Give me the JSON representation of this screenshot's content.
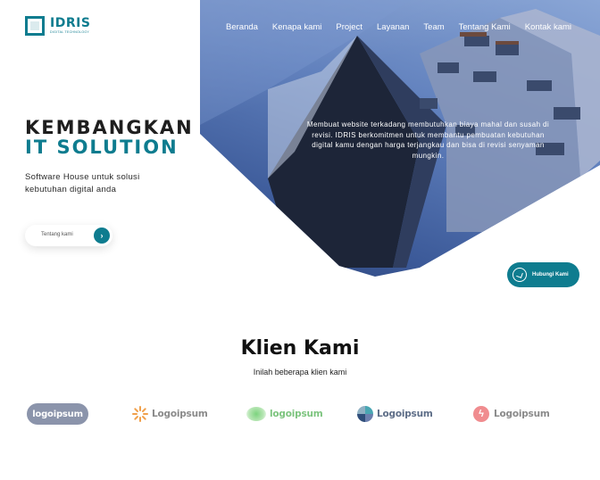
{
  "brand": {
    "name": "IDRIS",
    "tagline": "DIGITAL TECHNOLOGY",
    "accent": "#0e7c8f"
  },
  "nav": {
    "items": [
      "Beranda",
      "Kenapa kami",
      "Project",
      "Layanan",
      "Team",
      "Tentang Kami",
      "Kontak kami"
    ]
  },
  "hero": {
    "title_line1": "KEMBANGKAN",
    "title_line2": "IT SOLUTION",
    "description": "Software House untuk solusi kebutuhan digital anda",
    "cta_label": "Tentang kami",
    "overlay_text": "Membuat website terkadang membutuhkan biaya mahal dan susah di revisi. IDRIS berkomitmen untuk membantu pembuatan kebutuhan digital kamu dengan harga terjangkau dan bisa di revisi senyaman mungkin."
  },
  "whatsapp": {
    "label": "Hubungi Kami"
  },
  "clients": {
    "title": "Klien Kami",
    "subtitle": "Inilah beberapa klien kami",
    "logos": [
      "logoipsum",
      "Logoipsum",
      "logoipsum",
      "Logoipsum",
      "Logoipsum"
    ]
  }
}
